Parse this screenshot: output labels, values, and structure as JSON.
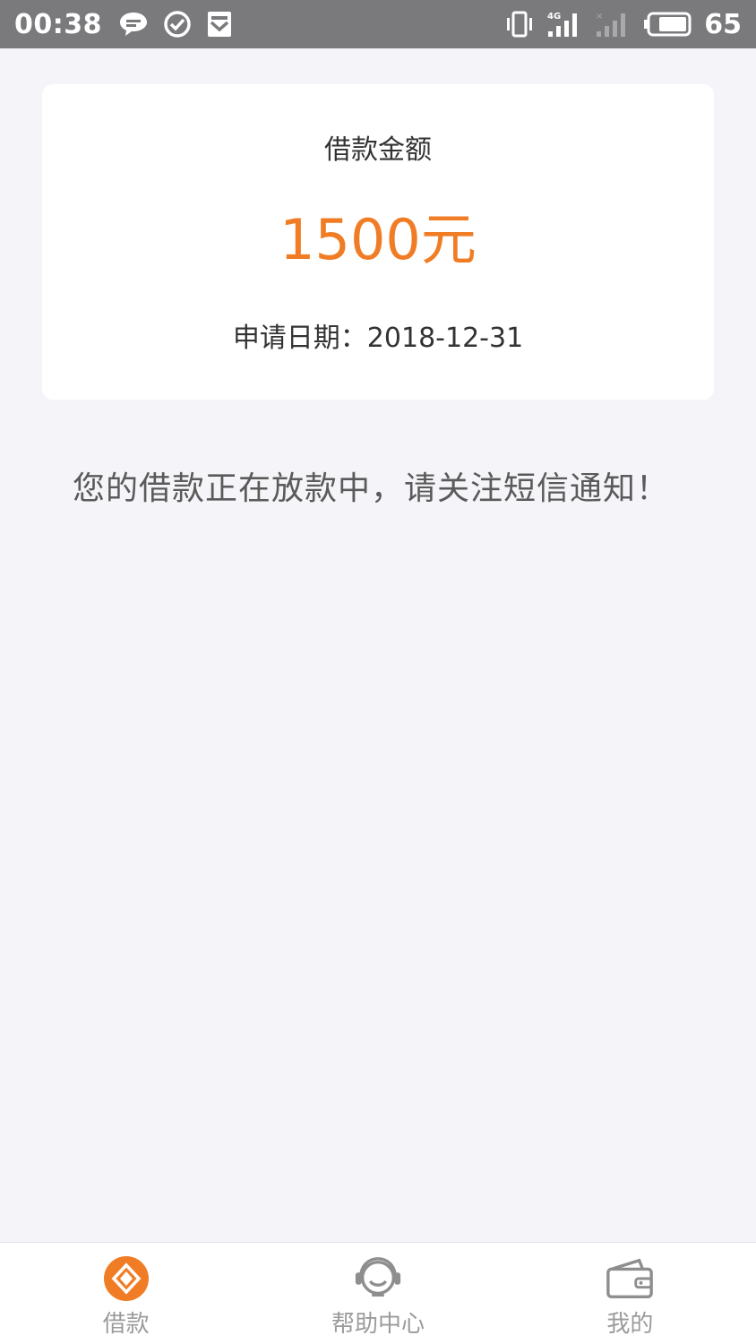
{
  "status_bar": {
    "time": "00:38",
    "battery": "65",
    "icons_left": [
      "message-icon",
      "check-circle-icon",
      "shield-mail-icon"
    ],
    "icons_right": [
      "vibrate-icon",
      "signal-4g-icon",
      "signal-empty-icon",
      "battery-icon"
    ]
  },
  "card": {
    "label": "借款金额",
    "amount": "1500元",
    "date": "申请日期：2018-12-31"
  },
  "notice": "您的借款正在放款中，请关注短信通知！",
  "tabs": [
    {
      "label": "借款",
      "icon": "loan-icon",
      "active": true
    },
    {
      "label": "帮助中心",
      "icon": "headset-icon",
      "active": false
    },
    {
      "label": "我的",
      "icon": "wallet-icon",
      "active": false
    }
  ],
  "colors": {
    "accent": "#f07d25",
    "status_bar": "#7a797c",
    "background": "#f5f4f8"
  }
}
